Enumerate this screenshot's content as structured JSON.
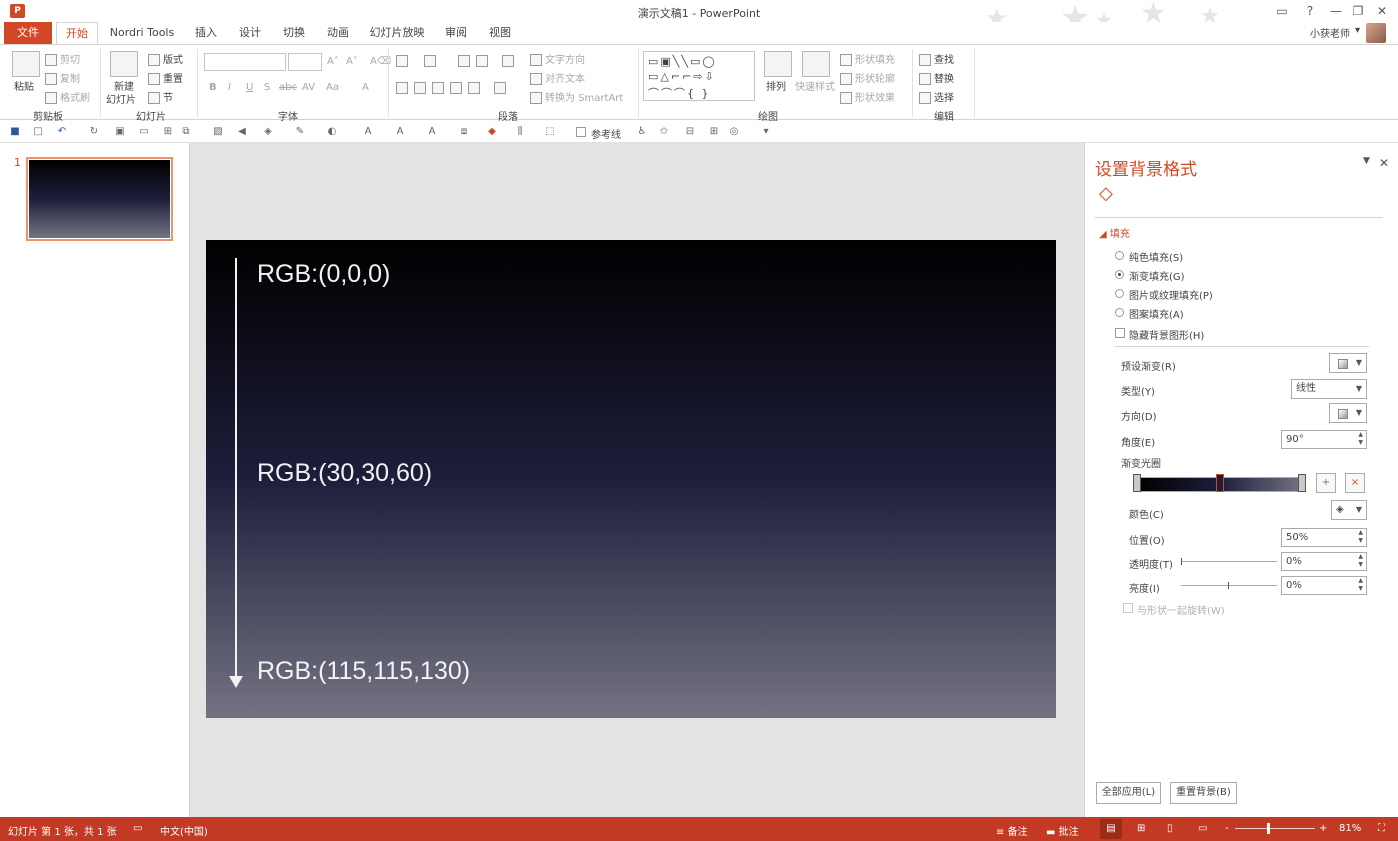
{
  "window": {
    "title": "演示文稿1 - PowerPoint",
    "app_icon": "P",
    "controls": {
      "help": "?",
      "ribbon_display": "▭",
      "minimize": "—",
      "restore": "❐",
      "close": "✕"
    }
  },
  "user": {
    "name": "小获老师",
    "dropdown": "▾"
  },
  "tabs": [
    {
      "label": "文件"
    },
    {
      "label": "开始"
    },
    {
      "label": "Nordri Tools"
    },
    {
      "label": "插入"
    },
    {
      "label": "设计"
    },
    {
      "label": "切换"
    },
    {
      "label": "动画"
    },
    {
      "label": "幻灯片放映"
    },
    {
      "label": "审阅"
    },
    {
      "label": "视图"
    }
  ],
  "ribbon": {
    "clipboard": {
      "paste": "粘贴",
      "cut": "剪切",
      "copy": "复制",
      "format_painter": "格式刷",
      "group_label": "剪贴板"
    },
    "slides": {
      "new_slide_1": "新建",
      "new_slide_2": "幻灯片",
      "layout": "版式",
      "reset": "重置",
      "section": "节",
      "group_label": "幻灯片"
    },
    "font": {
      "bold": "B",
      "italic": "I",
      "underline": "U",
      "shadow": "S",
      "strike": "abc",
      "spacing": "AV",
      "case": "Aa",
      "color": "A",
      "grow": "A˄",
      "shrink": "A˅",
      "clear": "A⌫",
      "group_label": "字体"
    },
    "paragraph": {
      "text_direction": "文字方向",
      "align_text": "对齐文本",
      "smartart": "转换为 SmartArt",
      "group_label": "段落"
    },
    "drawing": {
      "arrange": "排列",
      "quick_styles": "快速样式",
      "shape_fill": "形状填充",
      "shape_outline": "形状轮廓",
      "shape_effects": "形状效果",
      "group_label": "绘图"
    },
    "editing": {
      "find": "查找",
      "replace": "替换",
      "select": "选择",
      "group_label": "编辑"
    }
  },
  "qat": {
    "gridlines": "参考线"
  },
  "thumbnails": [
    {
      "number": "1"
    }
  ],
  "slide": {
    "labels": [
      "RGB:(0,0,0)",
      "RGB:(30,30,60)",
      "RGB:(115,115,130)"
    ],
    "gradient_colors": [
      "#000000",
      "#1e1e3c",
      "#737382"
    ]
  },
  "format_pane": {
    "title": "设置背景格式",
    "section": "填充",
    "options": [
      {
        "label": "纯色填充(S)",
        "selected": false
      },
      {
        "label": "渐变填充(G)",
        "selected": true
      },
      {
        "label": "图片或纹理填充(P)",
        "selected": false
      },
      {
        "label": "图案填充(A)",
        "selected": false
      }
    ],
    "hide_bg_graphics": "隐藏背景图形(H)",
    "preset_gradients": "预设渐变(R)",
    "type_label": "类型(Y)",
    "type_value": "线性",
    "direction_label": "方向(D)",
    "angle_label": "角度(E)",
    "angle_value": "90°",
    "gradient_stops_label": "渐变光圈",
    "color_label": "颜色(C)",
    "position_label": "位置(O)",
    "position_value": "50%",
    "transparency_label": "透明度(T)",
    "transparency_value": "0%",
    "brightness_label": "亮度(I)",
    "brightness_value": "0%",
    "rotate_with_shape": "与形状一起旋转(W)",
    "apply_all": "全部应用(L)",
    "reset_bg": "重置背景(B)"
  },
  "status": {
    "slide_info": "幻灯片 第 1 张，共 1 张",
    "language": "中文(中国)",
    "notes": "备注",
    "comments": "批注",
    "zoom": "81%",
    "zoom_minus": "-",
    "zoom_plus": "+"
  }
}
